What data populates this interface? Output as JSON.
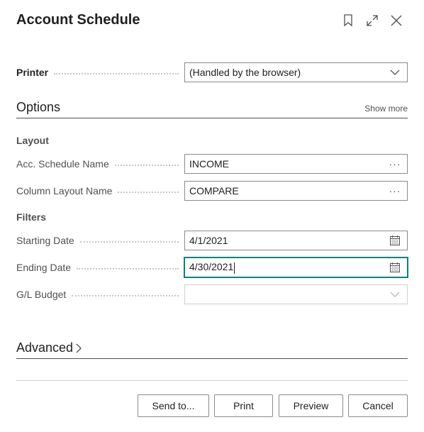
{
  "dialog": {
    "title": "Account Schedule"
  },
  "printer": {
    "label": "Printer",
    "value": "(Handled by the browser)"
  },
  "options": {
    "title": "Options",
    "show_more": "Show more"
  },
  "layout": {
    "group_label": "Layout",
    "acc_schedule_name": {
      "label": "Acc. Schedule Name",
      "value": "INCOME",
      "lookup": "···"
    },
    "column_layout_name": {
      "label": "Column Layout Name",
      "value": "COMPARE",
      "lookup": "···"
    }
  },
  "filters": {
    "group_label": "Filters",
    "starting_date": {
      "label": "Starting Date",
      "value": "4/1/2021"
    },
    "ending_date": {
      "label": "Ending Date",
      "value": "4/30/2021"
    },
    "gl_budget": {
      "label": "G/L Budget",
      "value": ""
    }
  },
  "advanced": {
    "title": "Advanced"
  },
  "buttons": {
    "send_to": "Send to...",
    "print": "Print",
    "preview": "Preview",
    "cancel": "Cancel"
  },
  "colors": {
    "focus_accent": "#00857a",
    "text": "#212121",
    "label": "#505050"
  }
}
